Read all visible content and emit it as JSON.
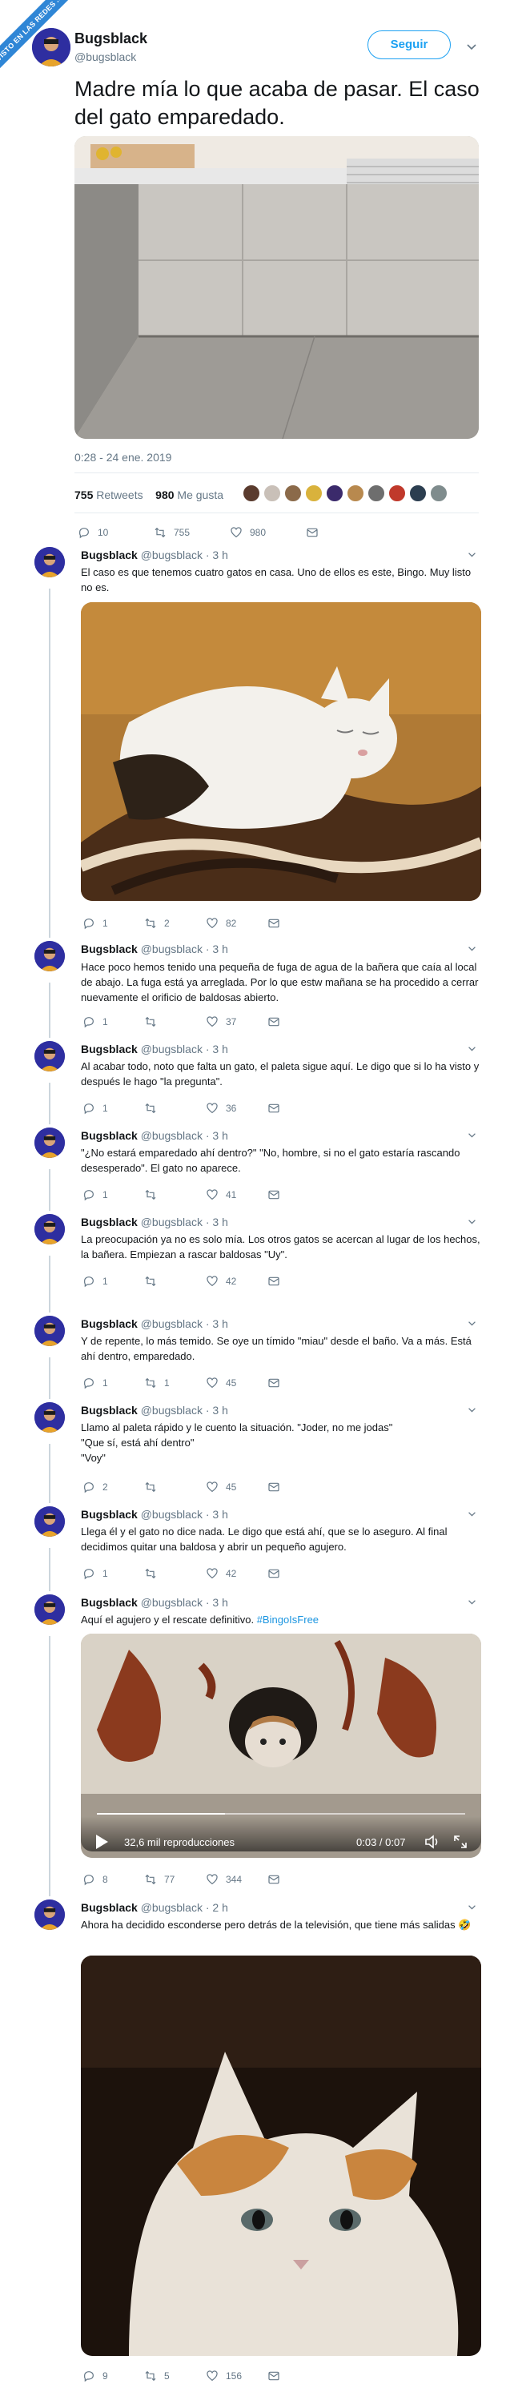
{
  "watermark": "VISTO EN LAS REDES .com",
  "main_tweet": {
    "name": "Bugsblack",
    "handle": "@bugsblack",
    "follow_label": "Seguir",
    "text": "Madre mía lo que acaba de pasar. El caso del gato emparedado.",
    "datetime": "0:28 - 24 ene. 2019",
    "retweets_count": "755",
    "retweets_label": "Retweets",
    "likes_count": "980",
    "likes_label": "Me gusta",
    "liker_colors": [
      "#5a3b2e",
      "#c9c0b8",
      "#8b6a4a",
      "#d9b23c",
      "#3b2a6b",
      "#b8894e",
      "#6e6e6e",
      "#c0392b",
      "#2c3e50",
      "#7f8c8d"
    ],
    "actions": {
      "replies": "10",
      "retweets": "755",
      "likes": "980"
    }
  },
  "replies": [
    {
      "name": "Bugsblack",
      "handle": "@bugsblack · 3 h",
      "text": "El caso es que tenemos cuatro gatos en casa. Uno de ellos es este, Bingo. Muy listo no es.",
      "actions": {
        "replies": "1",
        "retweets": "2",
        "likes": "82"
      }
    },
    {
      "name": "Bugsblack",
      "handle": "@bugsblack · 3 h",
      "text": "Hace poco hemos tenido una pequeña de fuga de agua de la bañera que caía al local de abajo. La fuga está ya arreglada. Por lo que estw mañana se ha procedido a cerrar nuevamente el orificio de baldosas abierto.",
      "actions": {
        "replies": "1",
        "retweets": "",
        "likes": "37"
      }
    },
    {
      "name": "Bugsblack",
      "handle": "@bugsblack · 3 h",
      "text": "Al acabar todo, noto que falta un gato, el paleta sigue aquí. Le digo que si lo ha visto y después le hago \"la pregunta\".",
      "actions": {
        "replies": "1",
        "retweets": "",
        "likes": "36"
      }
    },
    {
      "name": "Bugsblack",
      "handle": "@bugsblack · 3 h",
      "text": "\"¿No estará emparedado ahí dentro?\" \"No, hombre, si no el gato estaría rascando desesperado\". El gato no aparece.",
      "actions": {
        "replies": "1",
        "retweets": "",
        "likes": "41"
      }
    },
    {
      "name": "Bugsblack",
      "handle": "@bugsblack · 3 h",
      "text": "La preocupación ya no es solo mía. Los otros gatos se acercan al lugar de los hechos, la bañera. Empiezan a rascar baldosas \"Uy\".",
      "actions": {
        "replies": "1",
        "retweets": "",
        "likes": "42"
      }
    },
    {
      "name": "Bugsblack",
      "handle": "@bugsblack · 3 h",
      "text": "Y de repente, lo más temido. Se oye un tímido \"miau\" desde el baño. Va a más. Está ahí dentro, emparedado.",
      "actions": {
        "replies": "1",
        "retweets": "1",
        "likes": "45"
      }
    },
    {
      "name": "Bugsblack",
      "handle": "@bugsblack · 3 h",
      "text": "Llamo al paleta rápido y le cuento la situación. \"Joder, no me jodas\"\n\"Que sí, está ahí dentro\"\n\"Voy\"",
      "actions": {
        "replies": "2",
        "retweets": "",
        "likes": "45"
      }
    },
    {
      "name": "Bugsblack",
      "handle": "@bugsblack · 3 h",
      "text": "Llega él y el gato no dice nada. Le digo que está ahí, que se lo aseguro. Al final decidimos quitar una baldosa y abrir un pequeño agujero.",
      "actions": {
        "replies": "1",
        "retweets": "",
        "likes": "42"
      }
    },
    {
      "name": "Bugsblack",
      "handle": "@bugsblack · 3 h",
      "text": "Aquí el agujero y el rescate definitivo.",
      "hashtag": "#BingoIsFree",
      "video_views": "32,6 mil reproducciones",
      "video_time": "0:03 / 0:07",
      "actions": {
        "replies": "8",
        "retweets": "77",
        "likes": "344"
      }
    },
    {
      "name": "Bugsblack",
      "handle": "@bugsblack · 2 h",
      "text": "Ahora ha decidido esconderse pero detrás de la televisión, que tiene más salidas 🤣",
      "actions": {
        "replies": "9",
        "retweets": "5",
        "likes": "156"
      }
    }
  ]
}
